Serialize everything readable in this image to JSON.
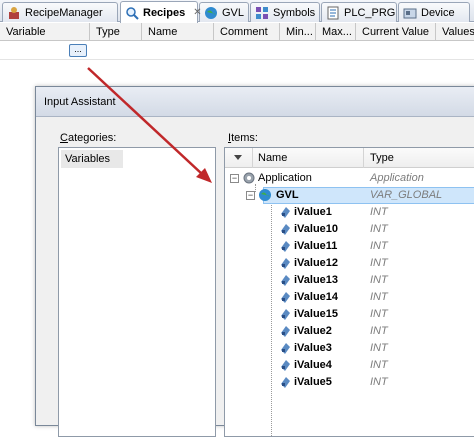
{
  "tabs": [
    {
      "label": "RecipeManager",
      "icon": "recipe-manager-icon",
      "active": false
    },
    {
      "label": "Recipes",
      "icon": "magnifier-icon",
      "active": true,
      "close": "✕"
    },
    {
      "label": "GVL",
      "icon": "globe-icon",
      "active": false
    },
    {
      "label": "Symbols",
      "icon": "symbols-icon",
      "active": false
    },
    {
      "label": "PLC_PRG",
      "icon": "program-icon",
      "active": false
    },
    {
      "label": "Device",
      "icon": "device-icon",
      "active": false
    }
  ],
  "grid": {
    "columns": [
      "Variable",
      "Type",
      "Name",
      "Comment",
      "Min...",
      "Max...",
      "Current Value",
      "Values"
    ],
    "ellipsis_label": "..."
  },
  "dialog": {
    "title": "Input Assistant",
    "categories_label": "Categories:",
    "categories_underline": "C",
    "categories_rest": "ategories:",
    "items_label_underline": "I",
    "items_label_rest": "tems:",
    "categories": [
      "Variables"
    ],
    "items_columns": {
      "name": "Name",
      "type": "Type"
    },
    "tree": {
      "application": {
        "name": "Application",
        "type": "Application"
      },
      "gvl": {
        "name": "GVL",
        "type": "VAR_GLOBAL"
      },
      "variables": [
        {
          "name": "iValue1",
          "type": "INT"
        },
        {
          "name": "iValue10",
          "type": "INT"
        },
        {
          "name": "iValue11",
          "type": "INT"
        },
        {
          "name": "iValue12",
          "type": "INT"
        },
        {
          "name": "iValue13",
          "type": "INT"
        },
        {
          "name": "iValue14",
          "type": "INT"
        },
        {
          "name": "iValue15",
          "type": "INT"
        },
        {
          "name": "iValue2",
          "type": "INT"
        },
        {
          "name": "iValue3",
          "type": "INT"
        },
        {
          "name": "iValue4",
          "type": "INT"
        },
        {
          "name": "iValue5",
          "type": "INT"
        }
      ]
    }
  },
  "colors": {
    "arrow": "#c0282a",
    "selection": "#cfe6fb",
    "type_text": "#7c7c7c"
  }
}
